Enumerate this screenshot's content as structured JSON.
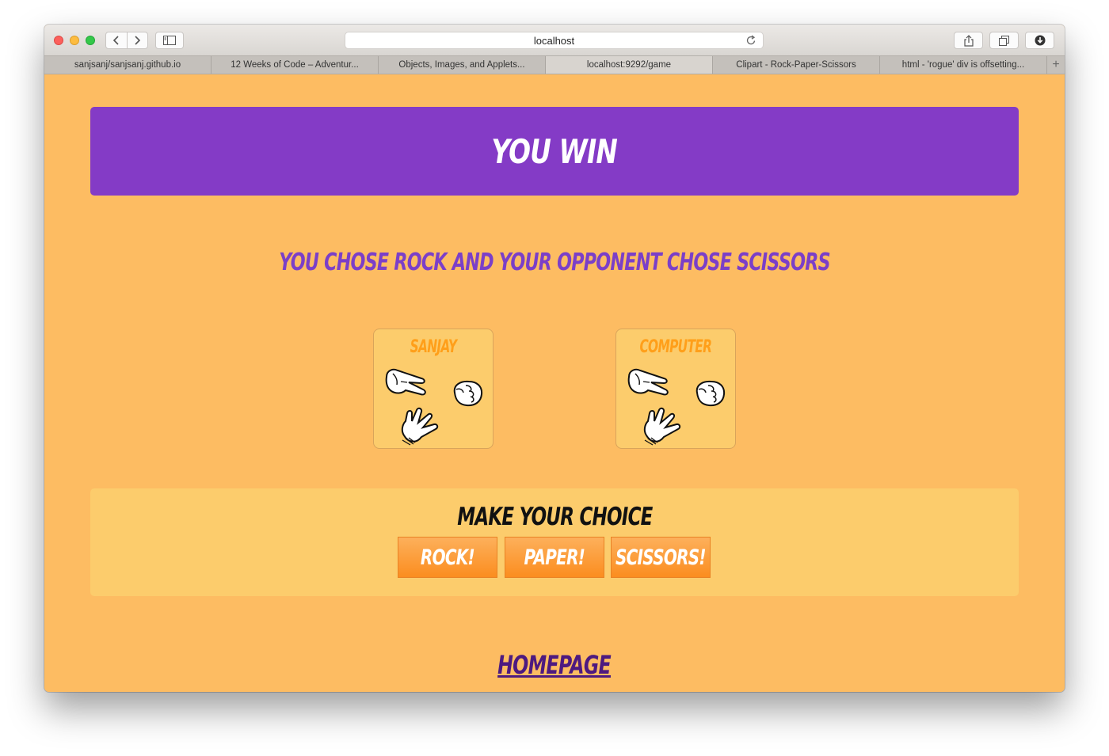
{
  "browser": {
    "address": "localhost",
    "tabs": [
      {
        "label": "sanjsanj/sanjsanj.github.io",
        "active": false
      },
      {
        "label": "12 Weeks of Code – Adventur...",
        "active": false
      },
      {
        "label": "Objects, Images, and Applets...",
        "active": false
      },
      {
        "label": "localhost:9292/game",
        "active": true
      },
      {
        "label": "Clipart - Rock-Paper-Scissors",
        "active": false
      },
      {
        "label": "html - 'rogue' div is offsetting...",
        "active": false
      }
    ],
    "new_tab_label": "+"
  },
  "game": {
    "result_title": "You Win",
    "result_message": "You chose ROCK and your opponent chose SCISSORS",
    "players": [
      {
        "name": "Sanjay"
      },
      {
        "name": "Computer"
      }
    ],
    "choice_title": "Make your choice",
    "choices": [
      "Rock!",
      "Paper!",
      "Scissors!"
    ],
    "homepage_link": "Homepage"
  },
  "colors": {
    "page_background": "#fdbc62",
    "banner": "#843bc6",
    "result_text": "#7b3fc8",
    "player_name": "#ff9f1a",
    "panel": "#fccc6c",
    "button": "#fb8d1f",
    "link": "#4d1a80"
  }
}
